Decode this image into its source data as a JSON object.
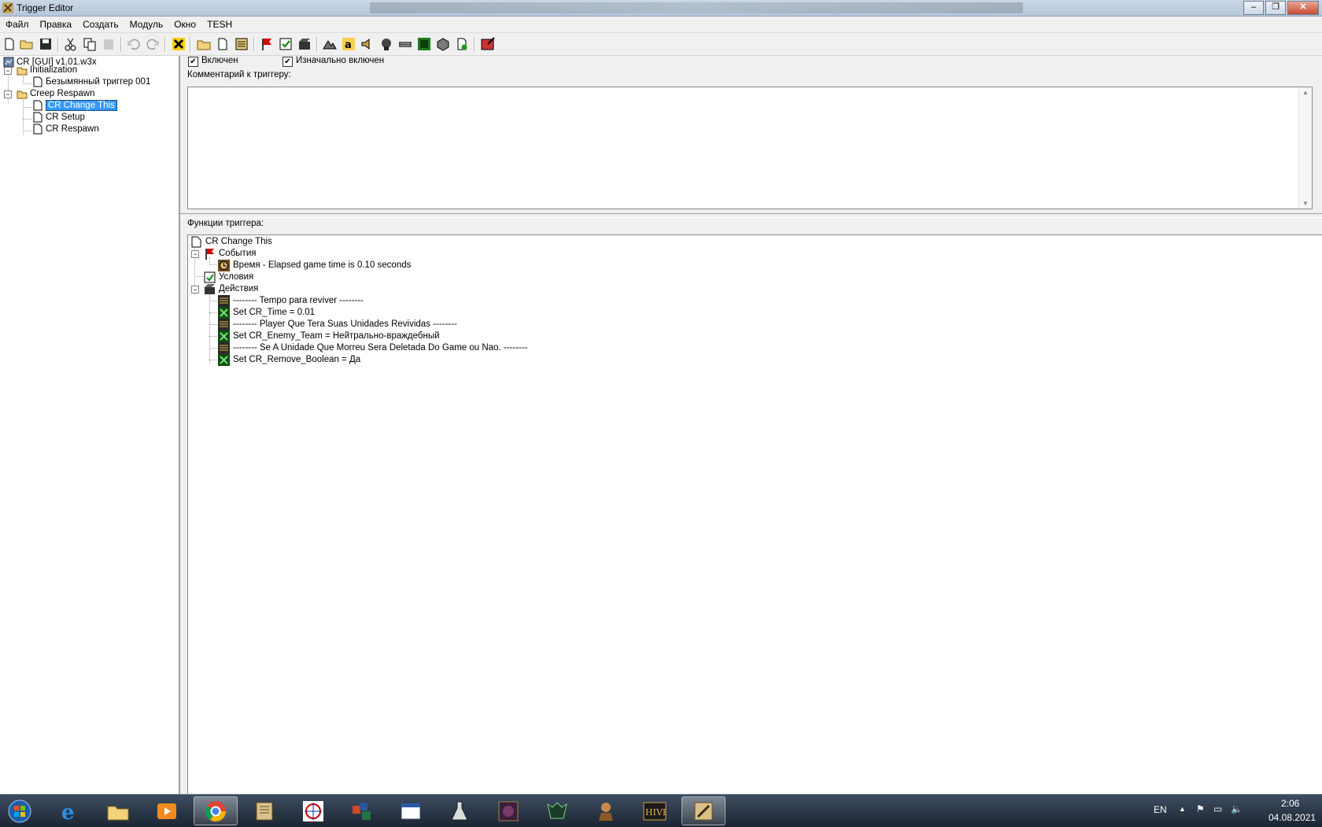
{
  "window": {
    "title": "Trigger Editor",
    "controls": [
      "minimize",
      "maximize",
      "close"
    ]
  },
  "menu": [
    "Файл",
    "Правка",
    "Создать",
    "Модуль",
    "Окно",
    "TESH"
  ],
  "toolbar_icons": [
    "new-icon",
    "open-icon",
    "save-icon",
    "cut-icon",
    "copy-icon",
    "paste-icon",
    "undo-icon",
    "redo-icon",
    "x-icon",
    "folder-icon",
    "trigger-icon",
    "comment-icon",
    "event-icon",
    "condition-icon",
    "action-icon",
    "terrain-icon",
    "unit-icon",
    "sound-icon",
    "object-icon",
    "camera-icon",
    "variable-icon",
    "import-icon",
    "script-icon",
    "test-map-icon"
  ],
  "tree": {
    "root": "CR [GUI] v1.01.w3x",
    "categories": [
      {
        "label": "Initialization",
        "items": [
          "Безымянный триггер 001"
        ]
      },
      {
        "label": "Creep Respawn",
        "items": [
          "CR Change This",
          "CR Setup",
          "CR Respawn"
        ]
      }
    ],
    "selected": "CR Change This"
  },
  "trigger": {
    "enabled_label": "Включен",
    "enabled": true,
    "initially_on_label": "Изначально включен",
    "initially_on": true,
    "comment_label": "Комментарий к триггеру:",
    "comment": "",
    "functions_label": "Функции триггера:"
  },
  "functions": {
    "name": "CR Change This",
    "events_label": "События",
    "events": [
      "Время - Elapsed game time is 0.10 seconds"
    ],
    "conditions_label": "Условия",
    "actions_label": "Действия",
    "actions": [
      {
        "type": "comment",
        "text": "-------- Tempo para reviver --------"
      },
      {
        "type": "set",
        "text": "Set CR_Time = 0.01"
      },
      {
        "type": "comment",
        "text": "-------- Player Que Tera Suas Unidades Revividas --------"
      },
      {
        "type": "set",
        "text": "Set CR_Enemy_Team = Нейтрально-враждебный"
      },
      {
        "type": "comment",
        "text": "-------- Se A Unidade Que Morreu Sera Deletada Do Game ou Nao. --------"
      },
      {
        "type": "set",
        "text": "Set CR_Remove_Boolean = Да"
      }
    ]
  },
  "taskbar": {
    "language": "EN",
    "time": "2:06",
    "date": "04.08.2021",
    "apps": [
      "start-orb-icon",
      "internet-explorer-icon",
      "explorer-icon",
      "media-player-icon",
      "chrome-icon",
      "scroll-editor-icon",
      "mox-icon",
      "office-icon",
      "window-app-icon",
      "flask-icon",
      "warcraft-icon",
      "wow-icon",
      "character-icon",
      "hive-icon",
      "trigger-editor-icon"
    ]
  }
}
